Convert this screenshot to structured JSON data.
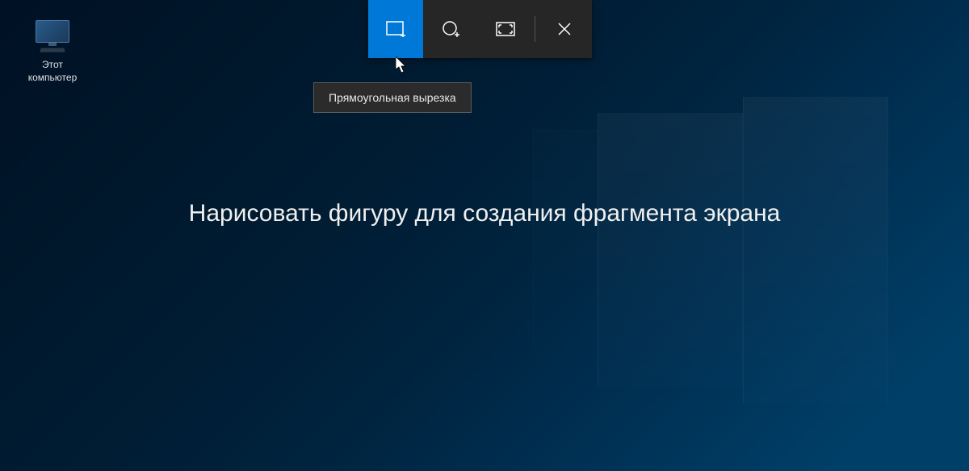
{
  "desktop": {
    "icon_label": "Этот\nкомпьютер"
  },
  "snip_toolbar": {
    "rectangular_tooltip": "Прямоугольная вырезка",
    "buttons": [
      {
        "name": "rectangular-snip",
        "active": true
      },
      {
        "name": "freeform-snip",
        "active": false
      },
      {
        "name": "fullscreen-snip",
        "active": false
      },
      {
        "name": "close",
        "active": false
      }
    ]
  },
  "instruction": "Нарисовать фигуру для создания фрагмента экрана"
}
